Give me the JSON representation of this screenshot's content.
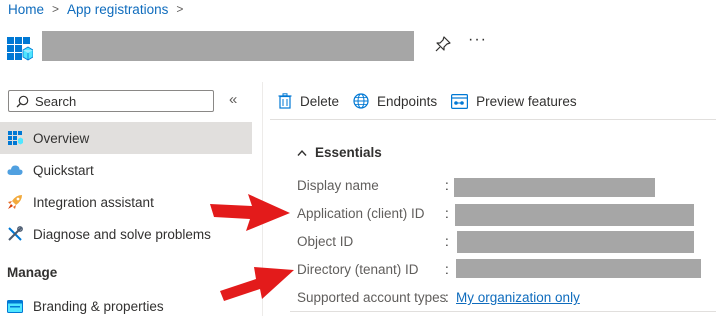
{
  "breadcrumb": {
    "home": "Home",
    "separator": ">",
    "app_registrations": "App registrations"
  },
  "header": {
    "pin_icon": "pin-icon",
    "more_label": "···"
  },
  "search": {
    "placeholder": "Search",
    "collapse": "«"
  },
  "nav": {
    "items": [
      {
        "label": "Overview",
        "icon": "overview-grid-icon",
        "selected": true
      },
      {
        "label": "Quickstart",
        "icon": "cloud-icon"
      },
      {
        "label": "Integration assistant",
        "icon": "rocket-icon"
      },
      {
        "label": "Diagnose and solve problems",
        "icon": "wrench-icon"
      }
    ],
    "section_manage": "Manage",
    "manage_items": [
      {
        "label": "Branding & properties",
        "icon": "branding-card-icon"
      }
    ]
  },
  "toolbar": {
    "delete": "Delete",
    "endpoints": "Endpoints",
    "preview": "Preview features"
  },
  "essentials": {
    "title": "Essentials",
    "colon": ":",
    "fields": [
      {
        "label": "Display name"
      },
      {
        "label": "Application (client) ID"
      },
      {
        "label": "Object ID"
      },
      {
        "label": "Directory (tenant) ID"
      },
      {
        "label": "Supported account types",
        "value": "My organization only"
      }
    ]
  },
  "colors": {
    "link": "#0f6cbd",
    "annotation_arrow": "#e31b1b",
    "redaction": "#a6a6a6",
    "selected_bg": "#e1dfdd"
  }
}
